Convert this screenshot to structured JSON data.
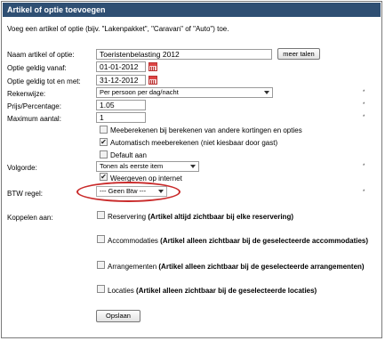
{
  "title": "Artikel of optie toevoegen",
  "intro": "Voeg een artikel of optie (bijv. \"Lakenpakket\", \"Caravan\" of \"Auto\") toe.",
  "fields": {
    "name_label": "Naam artikel of optie:",
    "name_value": "Toeristenbelasting 2012",
    "more_languages": "meer talen",
    "valid_from_label": "Optie geldig vanaf:",
    "valid_from_value": "01-01-2012",
    "valid_to_label": "Optie geldig tot en met:",
    "valid_to_value": "31-12-2012",
    "calc_label": "Rekenwijze:",
    "calc_value": "Per persoon per dag/nacht",
    "price_label": "Prijs/Percentage:",
    "price_value": "1.05",
    "max_label": "Maximum aantal:",
    "max_value": "1",
    "order_label": "Volgorde:",
    "order_value": "Tonen als eerste item",
    "btw_label": "BTW regel:",
    "btw_value": "--- Geen Btw ---",
    "link_label": "Koppelen aan:"
  },
  "required_mark": "*",
  "checkboxes": {
    "meebereken": {
      "label": "Meeberekenen bij berekenen van andere kortingen en opties",
      "checked": false
    },
    "auto": {
      "label": "Automatisch meeberekenen (niet kiesbaar door gast)",
      "checked": true
    },
    "default": {
      "label": "Default aan",
      "checked": false
    },
    "internet": {
      "label": "Weergeven op internet",
      "checked": true
    }
  },
  "links": [
    {
      "name": "Reservering",
      "note": "(Artikel altijd zichtbaar bij elke reservering)"
    },
    {
      "name": "Accommodaties",
      "note": "(Artikel alleen zichtbaar bij de geselecteerde accommodaties)"
    },
    {
      "name": "Arrangementen",
      "note": "(Artikel alleen zichtbaar bij de geselecteerde arrangementen)"
    },
    {
      "name": "Locaties",
      "note": "(Artikel alleen zichtbaar bij de geselecteerde locaties)"
    }
  ],
  "save_label": "Opslaan",
  "check_glyph": "✔",
  "highlight_color": "#c92a2a",
  "header_color": "#2f4f73"
}
